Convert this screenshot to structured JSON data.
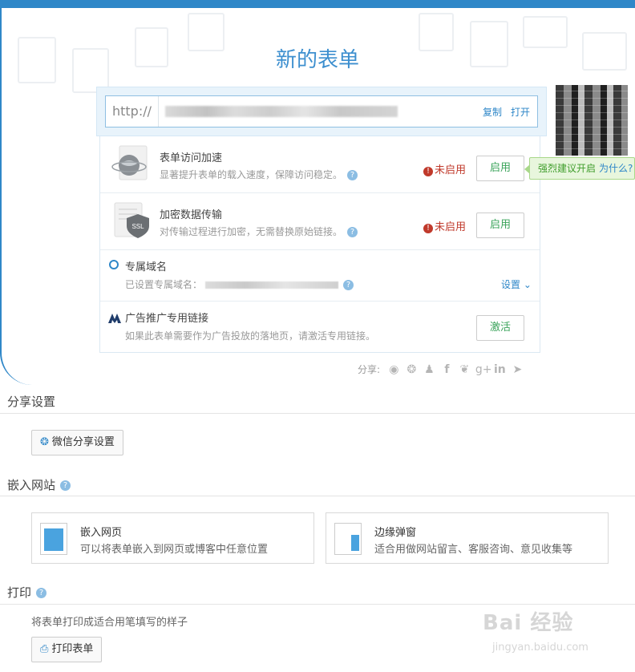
{
  "colors": {
    "brand": "#2f87c8",
    "success": "#3aa35a",
    "danger": "#c0392b"
  },
  "header": {
    "title": "新的表单"
  },
  "url_bar": {
    "prefix": "http://",
    "copy_label": "复制",
    "open_label": "打开"
  },
  "features": [
    {
      "icon": "globe-speed-icon",
      "title": "表单访问加速",
      "desc": "显著提升表单的载入速度，保障访问稳定。",
      "status": "未启用",
      "action": "启用"
    },
    {
      "icon": "ssl-shield-icon",
      "title": "加密数据传输",
      "desc": "对传输过程进行加密，无需替换原始链接。",
      "status": "未启用",
      "action": "启用"
    }
  ],
  "domain": {
    "title": "专属域名",
    "desc_prefix": "已设置专属域名：",
    "settings_label": "设置"
  },
  "ad_link": {
    "title": "广告推广专用链接",
    "desc": "如果此表单需要作为广告投放的落地页，请激活专用链接。",
    "action": "激活"
  },
  "tip": {
    "text": "强烈建议开启",
    "why": "为什么?"
  },
  "share": {
    "label": "分享:",
    "icons": [
      "weibo-icon",
      "wechat-icon",
      "qq-icon",
      "facebook-icon",
      "twitter-icon",
      "google-plus-icon",
      "linkedin-icon",
      "telegram-icon"
    ]
  },
  "sections": {
    "share_settings": {
      "title": "分享设置",
      "wechat_button": "微信分享设置"
    },
    "embed": {
      "title": "嵌入网站",
      "cards": [
        {
          "title": "嵌入网页",
          "desc": "可以将表单嵌入到网页或博客中任意位置"
        },
        {
          "title": "边缘弹窗",
          "desc": "适合用做网站留言、客服咨询、意见收集等"
        }
      ]
    },
    "print": {
      "title": "打印",
      "desc": "将表单打印成适合用笔填写的样子",
      "button": "打印表单"
    }
  },
  "watermark": {
    "brand": "Bai 经验",
    "url": "jingyan.baidu.com"
  }
}
